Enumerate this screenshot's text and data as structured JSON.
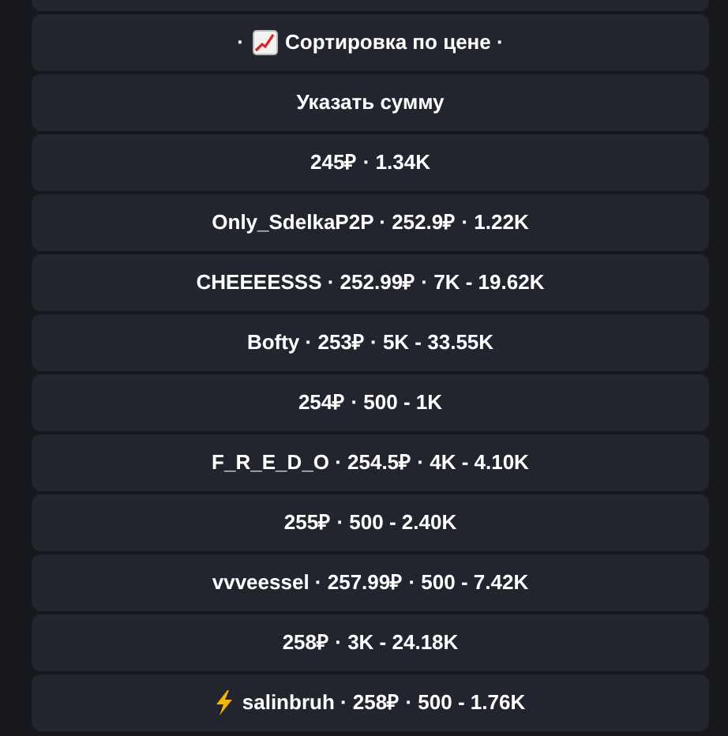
{
  "buttons": [
    {
      "kind": "chart",
      "prefix": "·",
      "text": "Сортировка по цене ·"
    },
    {
      "kind": "plain",
      "text": "Указать сумму"
    },
    {
      "kind": "plain",
      "text": "245₽ · 1.34K"
    },
    {
      "kind": "plain",
      "text": "Only_SdelkaP2P · 252.9₽ · 1.22K"
    },
    {
      "kind": "plain",
      "text": "CHEEEESSS · 252.99₽ · 7K - 19.62K"
    },
    {
      "kind": "plain",
      "text": "Bofty · 253₽ · 5K - 33.55K"
    },
    {
      "kind": "plain",
      "text": "254₽ · 500 - 1K"
    },
    {
      "kind": "plain",
      "text": "F_R_E_D_O · 254.5₽ · 4K - 4.10K"
    },
    {
      "kind": "plain",
      "text": "255₽ · 500 - 2.40K"
    },
    {
      "kind": "plain",
      "text": "vvveessel · 257.99₽ · 500 - 7.42K"
    },
    {
      "kind": "plain",
      "text": "258₽ · 3K - 24.18K"
    },
    {
      "kind": "bolt",
      "text": "salinbruh · 258₽ · 500 - 1.76K"
    }
  ]
}
